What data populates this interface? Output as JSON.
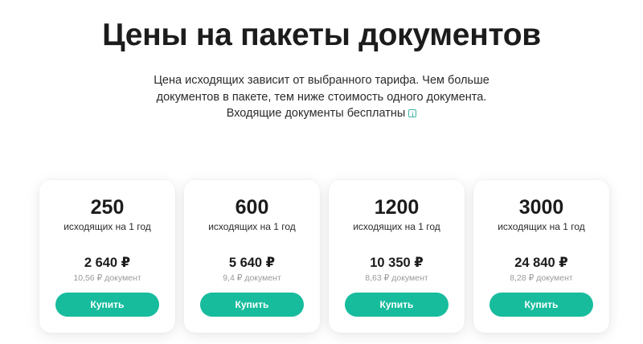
{
  "header": {
    "title": "Цены на пакеты документов",
    "subtitle_line1": "Цена исходящих зависит от выбранного тарифа. Чем больше",
    "subtitle_line2": "документов в пакете, тем ниже стоимость одного документа.",
    "subtitle_line3": "Входящие документы бесплатны",
    "info_icon": "info-icon"
  },
  "colors": {
    "accent": "#17bc9d",
    "text": "#1c1c1c",
    "muted": "#9a9a9a"
  },
  "packages": [
    {
      "quantity": "250",
      "quantity_label": "исходящих на 1 год",
      "price": "2 640 ₽",
      "per_document": "10,56 ₽ документ",
      "button_label": "Купить"
    },
    {
      "quantity": "600",
      "quantity_label": "исходящих на 1 год",
      "price": "5 640 ₽",
      "per_document": "9,4 ₽ документ",
      "button_label": "Купить"
    },
    {
      "quantity": "1200",
      "quantity_label": "исходящих на 1 год",
      "price": "10 350 ₽",
      "per_document": "8,63 ₽ документ",
      "button_label": "Купить"
    },
    {
      "quantity": "3000",
      "quantity_label": "исходящих на 1 год",
      "price": "24 840 ₽",
      "per_document": "8,28 ₽ документ",
      "button_label": "Купить"
    }
  ]
}
